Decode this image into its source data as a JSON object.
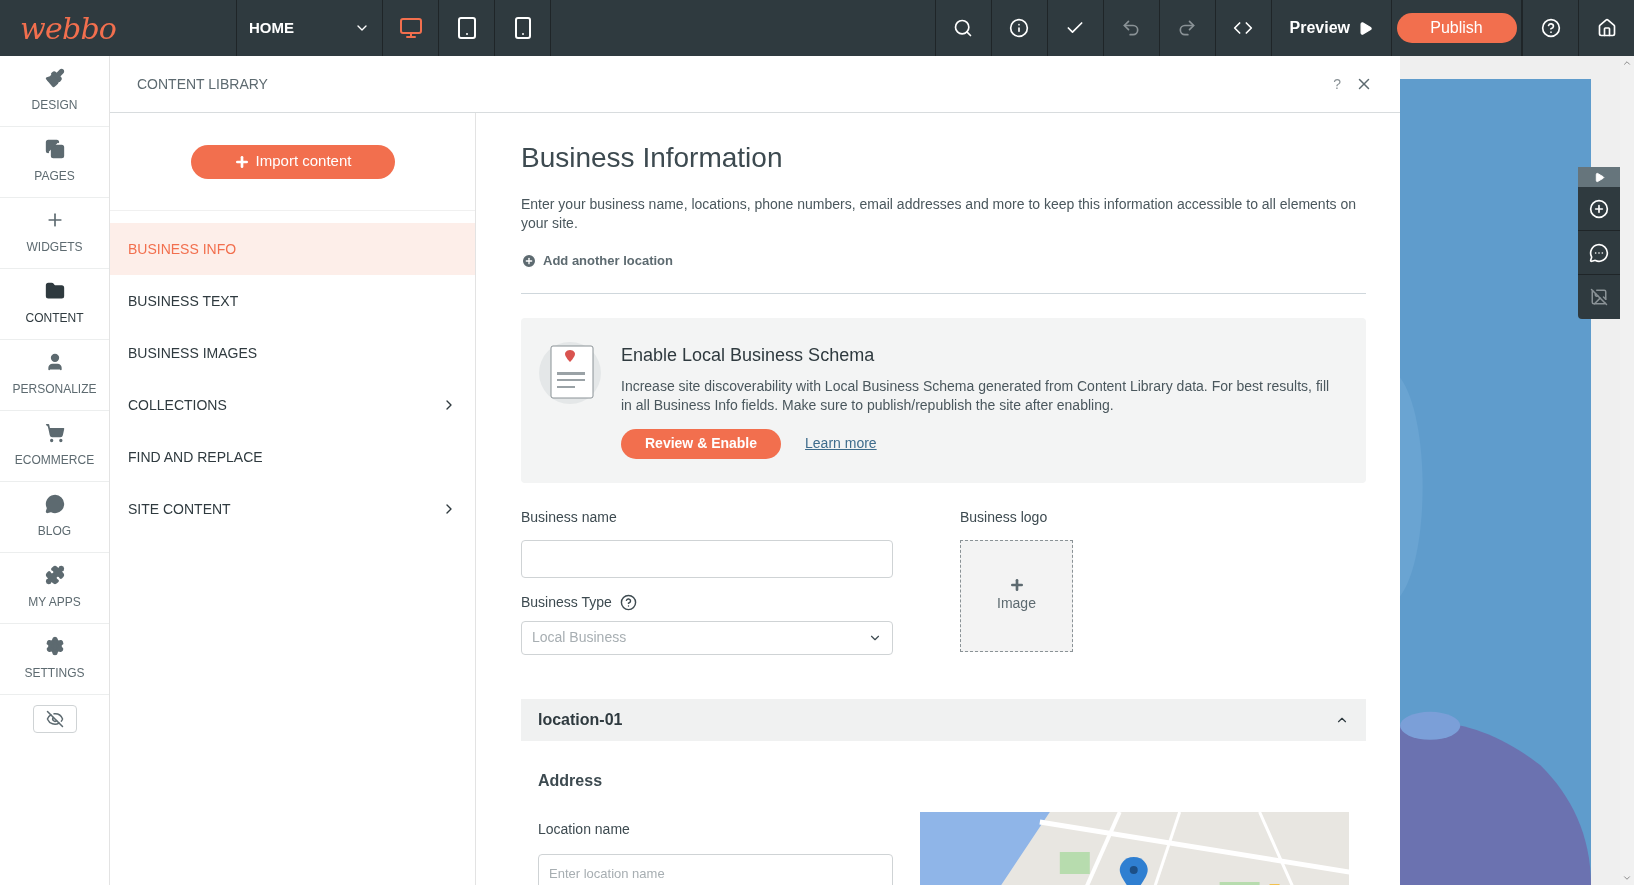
{
  "topbar": {
    "logo": "webbo",
    "page_select": "HOME",
    "devices": [
      {
        "kind": "desktop",
        "selected": true
      },
      {
        "kind": "tablet",
        "selected": false
      },
      {
        "kind": "mobile",
        "selected": false
      }
    ],
    "preview": "Preview",
    "publish": "Publish"
  },
  "rail": [
    {
      "kind": "brush",
      "label": "DESIGN",
      "selected": false
    },
    {
      "kind": "pages",
      "label": "PAGES",
      "selected": false
    },
    {
      "kind": "plus",
      "label": "WIDGETS",
      "selected": false
    },
    {
      "kind": "folder",
      "label": "CONTENT",
      "selected": true
    },
    {
      "kind": "person",
      "label": "PERSONALIZE",
      "selected": false
    },
    {
      "kind": "cart",
      "label": "ECOMMERCE",
      "selected": false
    },
    {
      "kind": "bubble",
      "label": "BLOG",
      "selected": false
    },
    {
      "kind": "puzzle",
      "label": "MY APPS",
      "selected": false
    },
    {
      "kind": "gear",
      "label": "SETTINGS",
      "selected": false
    }
  ],
  "panel": {
    "title": "CONTENT LIBRARY",
    "help": "?",
    "import_button": "Import content",
    "nav": [
      {
        "label": "BUSINESS INFO",
        "selected": true,
        "has_children": false
      },
      {
        "label": "BUSINESS TEXT",
        "selected": false,
        "has_children": false
      },
      {
        "label": "BUSINESS IMAGES",
        "selected": false,
        "has_children": false
      },
      {
        "label": "COLLECTIONS",
        "selected": false,
        "has_children": true
      },
      {
        "label": "FIND AND REPLACE",
        "selected": false,
        "has_children": false
      },
      {
        "label": "SITE CONTENT",
        "selected": false,
        "has_children": true
      }
    ]
  },
  "main": {
    "title": "Business Information",
    "description": "Enter your business name, locations, phone numbers, email addresses and more to keep this information accessible to all elements on your site.",
    "add_location": "Add another location",
    "schema_card": {
      "title": "Enable Local Business Schema",
      "text": "Increase site discoverability with Local Business Schema generated from Content Library data. For best results, fill in all Business Info fields. Make sure to publish/republish the site after enabling.",
      "button": "Review & Enable",
      "link": "Learn more"
    },
    "business_name": {
      "label": "Business name"
    },
    "business_type": {
      "label": "Business Type",
      "placeholder": "Local Business"
    },
    "business_logo": {
      "label": "Business logo",
      "button": "Image"
    },
    "location": {
      "title": "location-01",
      "expanded": true,
      "section": "Address",
      "location_name": {
        "label": "Location name",
        "placeholder": "Enter location name"
      }
    }
  }
}
